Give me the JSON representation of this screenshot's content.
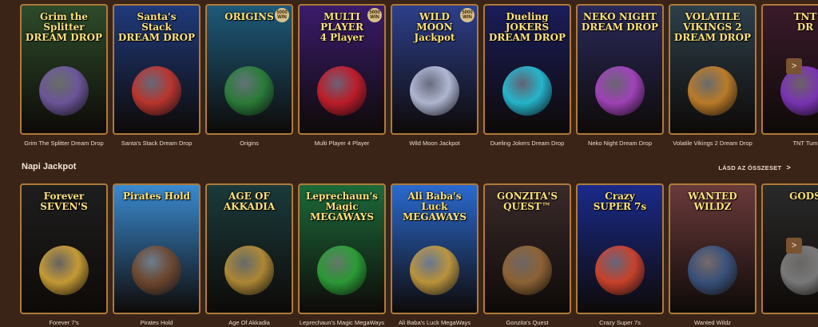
{
  "row1": {
    "games": [
      {
        "name": "Grim The Splitter Dream Drop",
        "art": "Grim the Splitter\nDREAM DROP",
        "bg": "#2d4b2a",
        "accent": "#7a5fb0"
      },
      {
        "name": "Santa's Stack Dream Drop",
        "art": "Santa's\nStack\nDREAM DROP",
        "bg": "#1f3a7a",
        "accent": "#d63a2f"
      },
      {
        "name": "Origins",
        "art": "ORIGINS",
        "bg": "#1d5a7a",
        "accent": "#2f8a3b",
        "badge": "5000 WIN"
      },
      {
        "name": "Multi Player 4 Player",
        "art": "MULTI\nPLAYER\n4 Player",
        "bg": "#3b1b6b",
        "accent": "#d81f2a",
        "badge": "5000 WIN"
      },
      {
        "name": "Wild Moon Jackpot",
        "art": "WILD\nMOON\nJackpot",
        "bg": "#2d3f8a",
        "accent": "#c9d1ec",
        "badge": "5000 WIN"
      },
      {
        "name": "Dueling Jokers Dream Drop",
        "art": "Dueling\nJOKERS\nDREAM DROP",
        "bg": "#1a1d5a",
        "accent": "#29d1e8"
      },
      {
        "name": "Neko Night Dream Drop",
        "art": "NEKO NIGHT\nDREAM DROP",
        "bg": "#2a2a5a",
        "accent": "#b64ad0"
      },
      {
        "name": "Volatile Vikings 2 Dream Drop",
        "art": "VOLATILE\nVIKINGS 2\nDREAM DROP",
        "bg": "#2d3f4a",
        "accent": "#d68b2a"
      },
      {
        "name": "TNT Tum",
        "art": "TNT\nDR",
        "bg": "#3a1a2a",
        "accent": "#8a3ad0"
      }
    ]
  },
  "section": {
    "title": "Napi Jackpot",
    "see_all": "LÁSD AZ ÖSSZESET",
    "chevron": ">"
  },
  "row2": {
    "games": [
      {
        "name": "Forever 7's",
        "art": "Forever\nSEVEN'S",
        "bg": "#1e1e1e",
        "accent": "#e3b23c"
      },
      {
        "name": "Pirates Hold",
        "art": "Pirates Hold",
        "bg": "#3a8ad0",
        "accent": "#7a4a2a"
      },
      {
        "name": "Age Of Akkadia",
        "art": "AGE OF AKKADIA",
        "bg": "#1a3a3a",
        "accent": "#c89a3a"
      },
      {
        "name": "Leprechaun's Magic MegaWays",
        "art": "Leprechaun's Magic\nMEGAWAYS",
        "bg": "#1d6a3a",
        "accent": "#2fae3b"
      },
      {
        "name": "Ali Baba's Luck MegaWays",
        "art": "Ali Baba's Luck\nMEGAWAYS",
        "bg": "#2a6ad0",
        "accent": "#d6a63a"
      },
      {
        "name": "Gonzita's Quest",
        "art": "GONZITA'S\nQUEST™",
        "bg": "#3a2a2a",
        "accent": "#a0703a"
      },
      {
        "name": "Crazy Super 7s",
        "art": "Crazy\nSUPER 7s",
        "bg": "#1a2a8a",
        "accent": "#e84a2a"
      },
      {
        "name": "Wanted Wildz",
        "art": "WANTED WILDZ",
        "bg": "#6a3a3a",
        "accent": "#3a5a8a"
      },
      {
        "name": "",
        "art": "GODS",
        "bg": "#2a2a2a",
        "accent": "#8a8a8a"
      }
    ]
  },
  "nav": {
    "next": ">"
  }
}
